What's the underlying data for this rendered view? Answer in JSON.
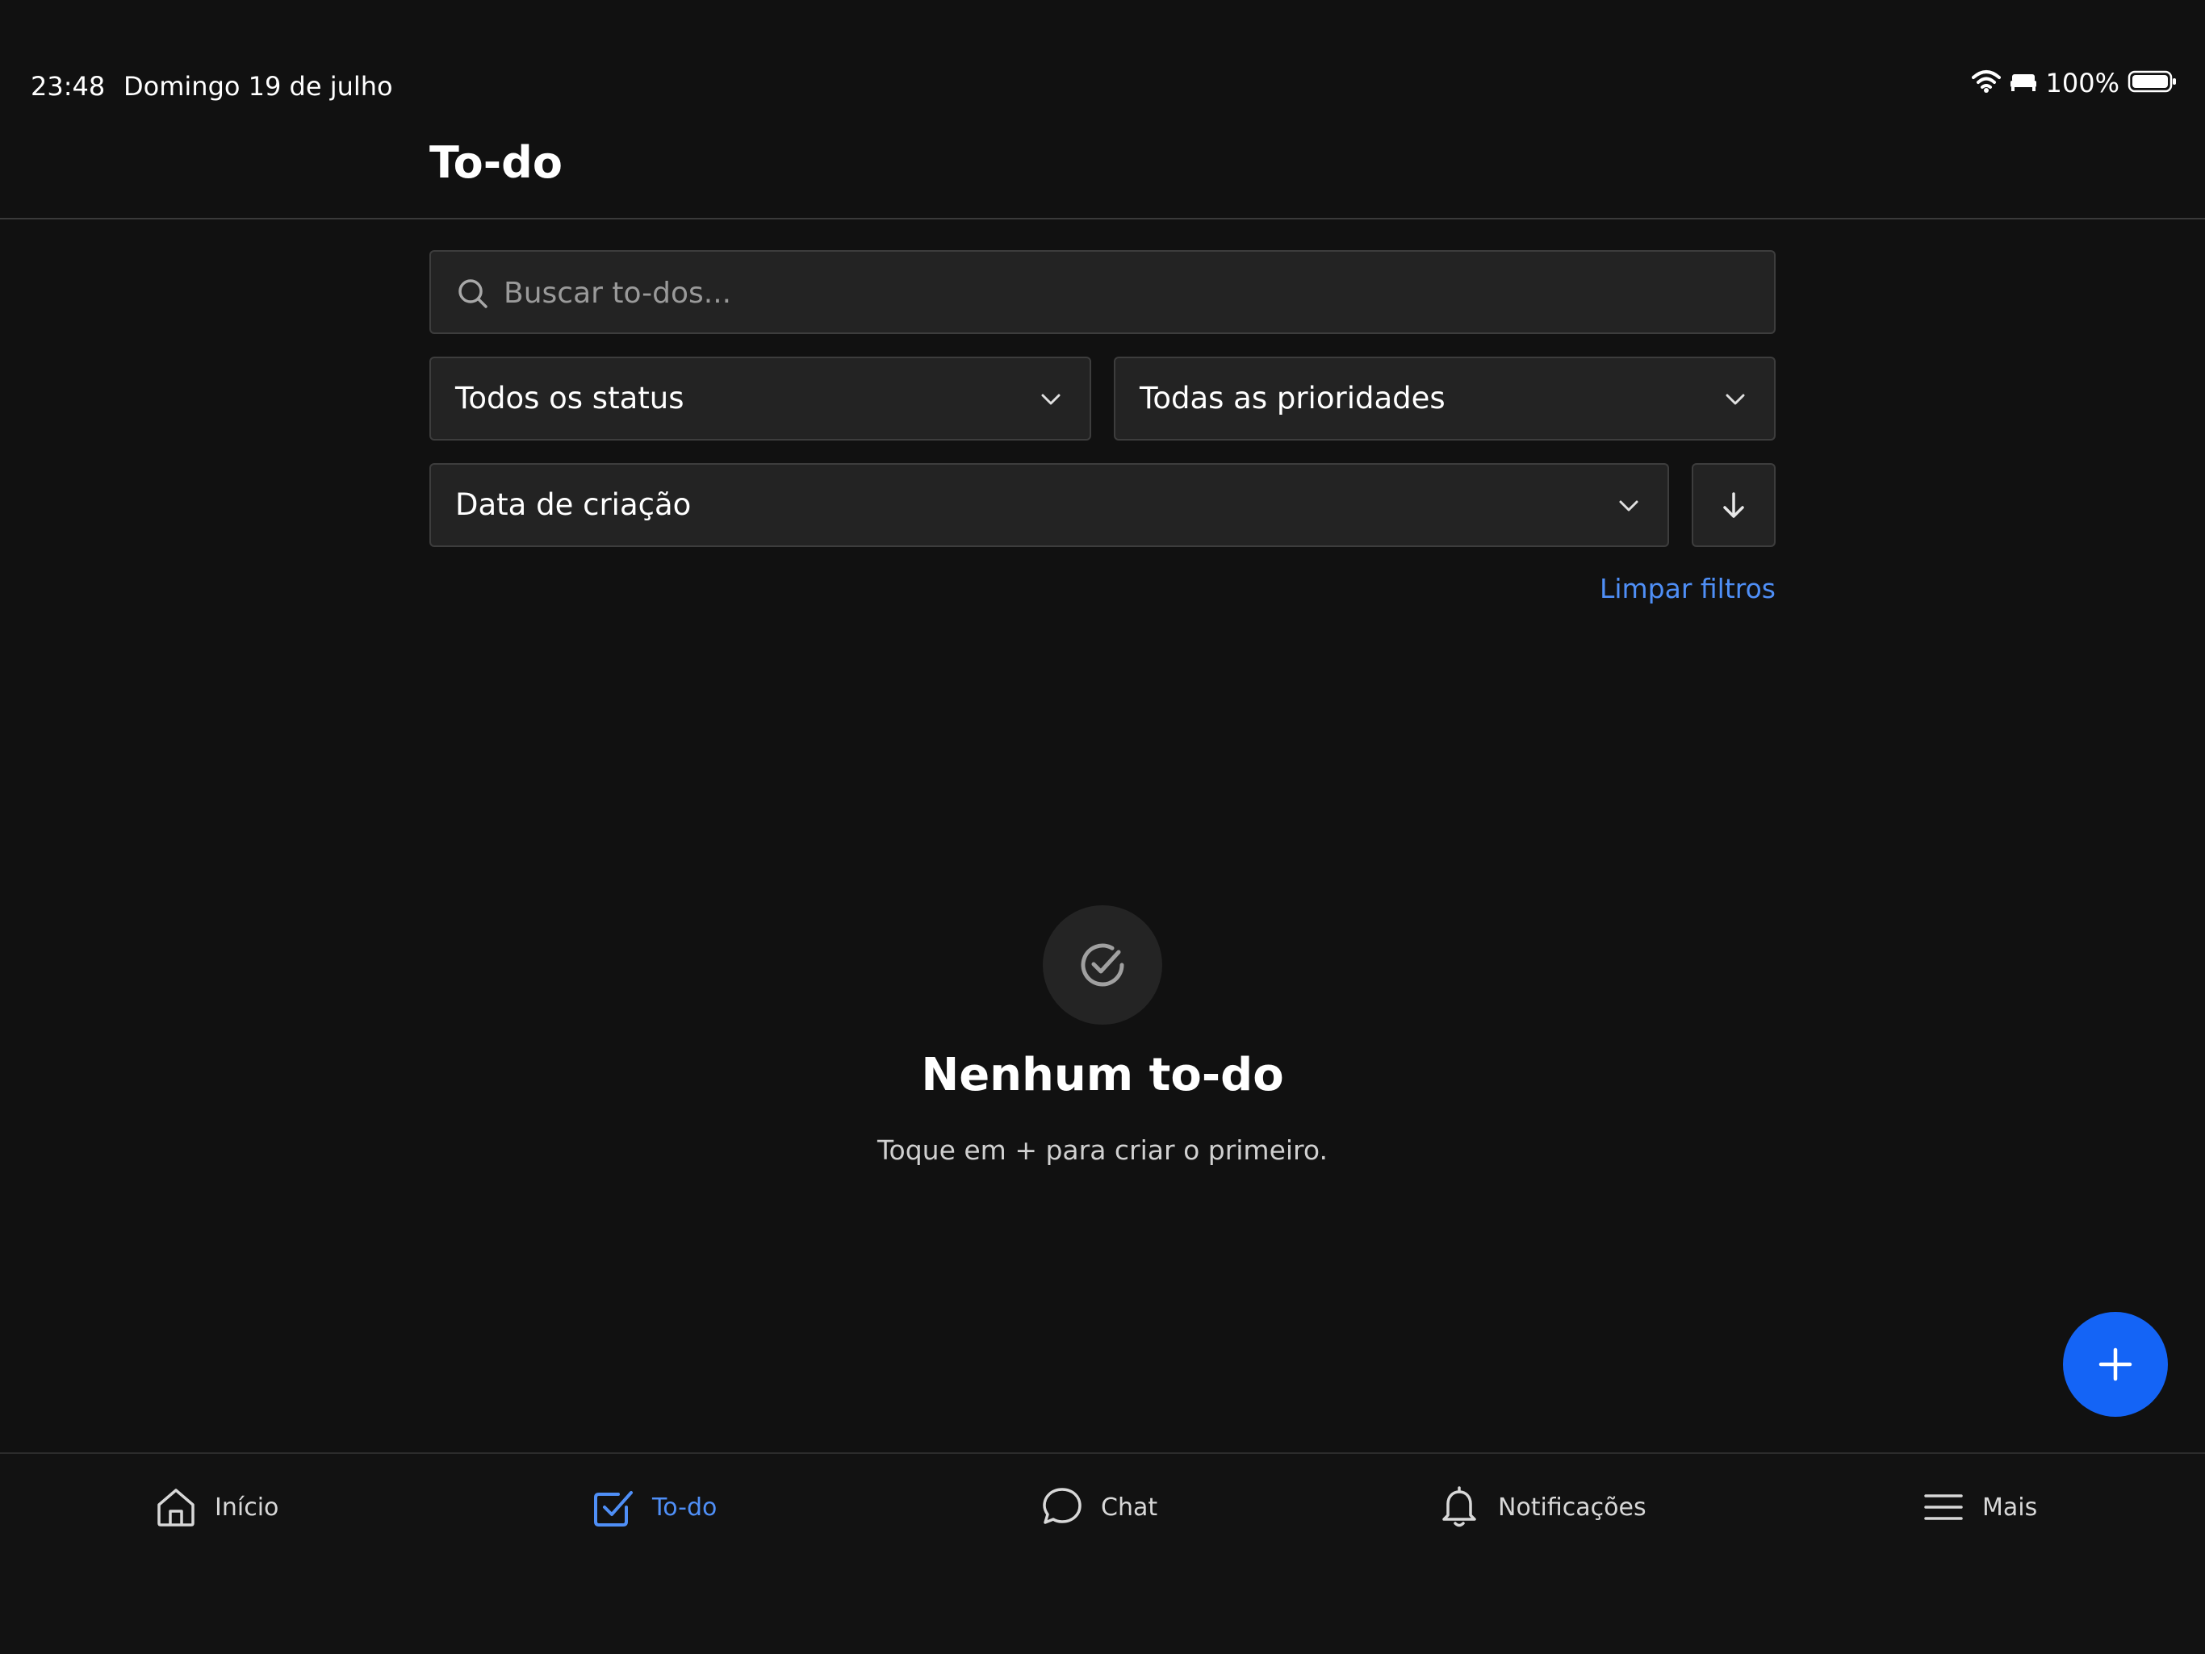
{
  "status_bar": {
    "time": "23:48",
    "date": "Domingo 19 de julho",
    "battery": "100%"
  },
  "header": {
    "title": "To-do"
  },
  "search": {
    "placeholder": "Buscar to-dos...",
    "value": ""
  },
  "filters": {
    "status": "Todos os status",
    "priority": "Todas as prioridades",
    "sort": "Data de criação",
    "clear_label": "Limpar filtros"
  },
  "empty_state": {
    "title": "Nenhum to-do",
    "subtitle": "Toque em + para criar o primeiro."
  },
  "tabbar": {
    "items": [
      {
        "label": "Início",
        "icon": "home-icon"
      },
      {
        "label": "To-do",
        "icon": "checkbox-icon",
        "active": true
      },
      {
        "label": "Chat",
        "icon": "chat-bubble-icon"
      },
      {
        "label": "Notificações",
        "icon": "bell-icon"
      },
      {
        "label": "Mais",
        "icon": "menu-icon"
      }
    ]
  },
  "colors": {
    "background": "#111111",
    "accent": "#4f8ff7",
    "fab": "#1464f6",
    "field": "#232323"
  }
}
